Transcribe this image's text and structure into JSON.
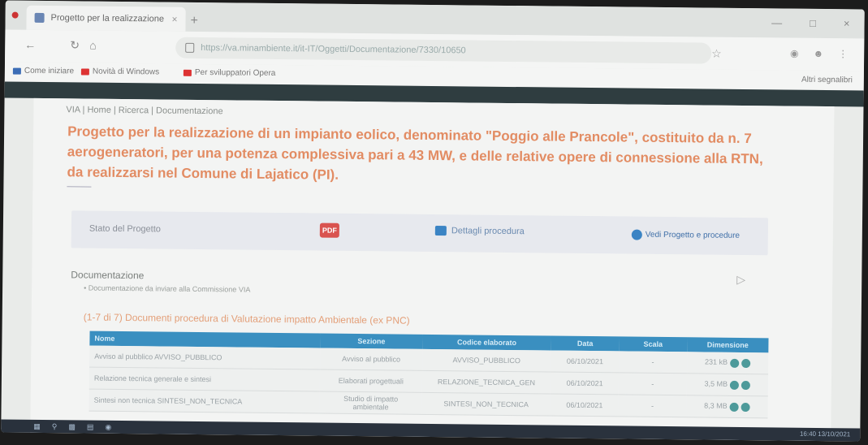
{
  "browser": {
    "tab_title": "Progetto per la realizzazione d...",
    "tab_close": "×",
    "new_tab": "+",
    "address": "https://va.minambiente.it/it-IT/Oggetti/Documentazione/7330/10650",
    "bookmarks": [
      "Come iniziare",
      "Novità di Windows",
      "Per sviluppatori Opera"
    ],
    "other_bookmarks": "Altri segnalibri"
  },
  "page": {
    "breadcrumb": "VIA | Home | Ricerca | Documentazione",
    "title": "Progetto per la realizzazione di un impianto eolico, denominato \"Poggio alle Prancole\", costituito da n. 7 aerogeneratori, per una potenza complessiva pari a 43 MW, e delle relative opere di connessione alla RTN, da realizzarsi nel Comune di Lajatico (PI).",
    "infobox": {
      "label": "Stato del Progetto",
      "pdf_label": "PDF",
      "link1": "Dettagli procedura",
      "link2": "Vedi Progetto e procedure"
    },
    "section_heading": "Documentazione",
    "section_bullet": "Documentazione da inviare alla Commissione VIA",
    "docs_heading": "(1-7 di 7) Documenti procedura di Valutazione impatto Ambientale (ex PNC)"
  },
  "table": {
    "headers": [
      "Nome",
      "Sezione",
      "Codice elaborato",
      "Data",
      "Scala",
      "Dimensione"
    ],
    "rows": [
      [
        "Avviso al pubblico AVVISO_PUBBLICO",
        "Avviso al pubblico",
        "AVVISO_PUBBLICO",
        "06/10/2021",
        "-",
        "231 kB"
      ],
      [
        "Relazione tecnica generale e sintesi",
        "Elaborati progettuali",
        "RELAZIONE_TECNICA_GEN",
        "06/10/2021",
        "-",
        "3,5 MB"
      ],
      [
        "Sintesi non tecnica SINTESI_NON_TECNICA",
        "Studio di impatto ambientale",
        "SINTESI_NON_TECNICA",
        "06/10/2021",
        "-",
        "8,3 MB"
      ]
    ]
  },
  "taskbar": {
    "time": "16:40  13/10/2021"
  }
}
